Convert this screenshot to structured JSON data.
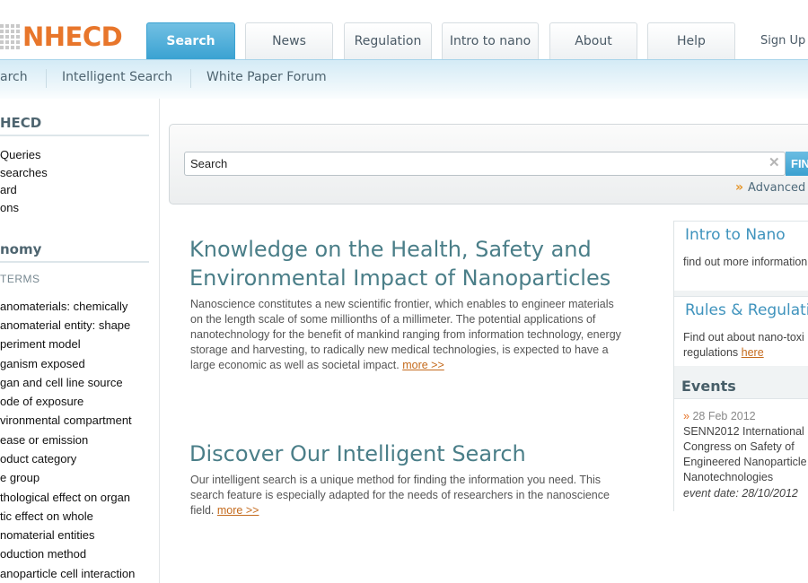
{
  "header": {
    "logo": "NHECD",
    "tabs": [
      {
        "label": "Search",
        "active": true
      },
      {
        "label": "News"
      },
      {
        "label": "Regulation"
      },
      {
        "label": "Intro to nano"
      },
      {
        "label": "About"
      },
      {
        "label": "Help"
      }
    ],
    "signup": "Sign Up"
  },
  "subnav": {
    "items": [
      "arch",
      "Intelligent Search",
      "White Paper Forum"
    ]
  },
  "sidebar": {
    "section1_title": "HECD",
    "section1_links": [
      "Queries",
      "searches",
      "ard",
      "ons"
    ],
    "section2_title": "nomy",
    "section2_sub": "TERMS",
    "section2_links": [
      "anomaterials: chemically",
      "anomaterial entity: shape",
      "periment model",
      "ganism exposed",
      "gan and cell line source",
      "ode of exposure",
      "vironmental compartment",
      "ease or emission",
      "oduct category",
      "e group",
      "thological effect on organ",
      "tic effect on whole",
      "nomaterial entities",
      "oduction method",
      "anoparticle cell interaction"
    ]
  },
  "search": {
    "value": "Search",
    "clear_icon": "clear-x-icon",
    "find_label": "FIN",
    "advanced_label": "Advanced"
  },
  "main": {
    "section1": {
      "heading_line1": "Knowledge on the Health, Safety and",
      "heading_line2": "Environmental Impact of Nanoparticles",
      "para_lines": [
        "Nanoscience constitutes a new scientific frontier, which enables to engineer materials",
        "on the length scale of some millionths of a millimeter. The potential applications of",
        "nanotechnology for the benefit of mankind ranging from information technology, energy",
        "storage and harvesting, to radically new medical technologies, is expected to have a",
        "large economic as well as societal impact."
      ],
      "more": "more >>"
    },
    "section2": {
      "heading": "Discover Our Intelligent Search",
      "para_lines": [
        "Our intelligent search is a unique method for finding the information you need. This",
        "search feature is especially adapted for the needs of researchers in the nanoscience",
        "field."
      ],
      "more": "more >>"
    }
  },
  "right": {
    "intro_title": "Intro to Nano",
    "intro_text": "find out more information",
    "rules_title": "Rules & Regulations",
    "rules_text_line1": "Find out about nano-toxi",
    "rules_text_line2": "regulations",
    "rules_link": "here",
    "events_title": "Events",
    "event_date": "28 Feb 2012",
    "event_lines": [
      "SENN2012 International",
      "Congress on Safety of",
      "Engineered Nanoparticle",
      "Nanotechnologies"
    ],
    "event_footer": "event date: 28/10/2012"
  },
  "colors": {
    "brand_orange": "#e8762b",
    "tab_active": "#3aa2d2",
    "heading_teal": "#4a7e88",
    "link_orange": "#c46a1c"
  }
}
